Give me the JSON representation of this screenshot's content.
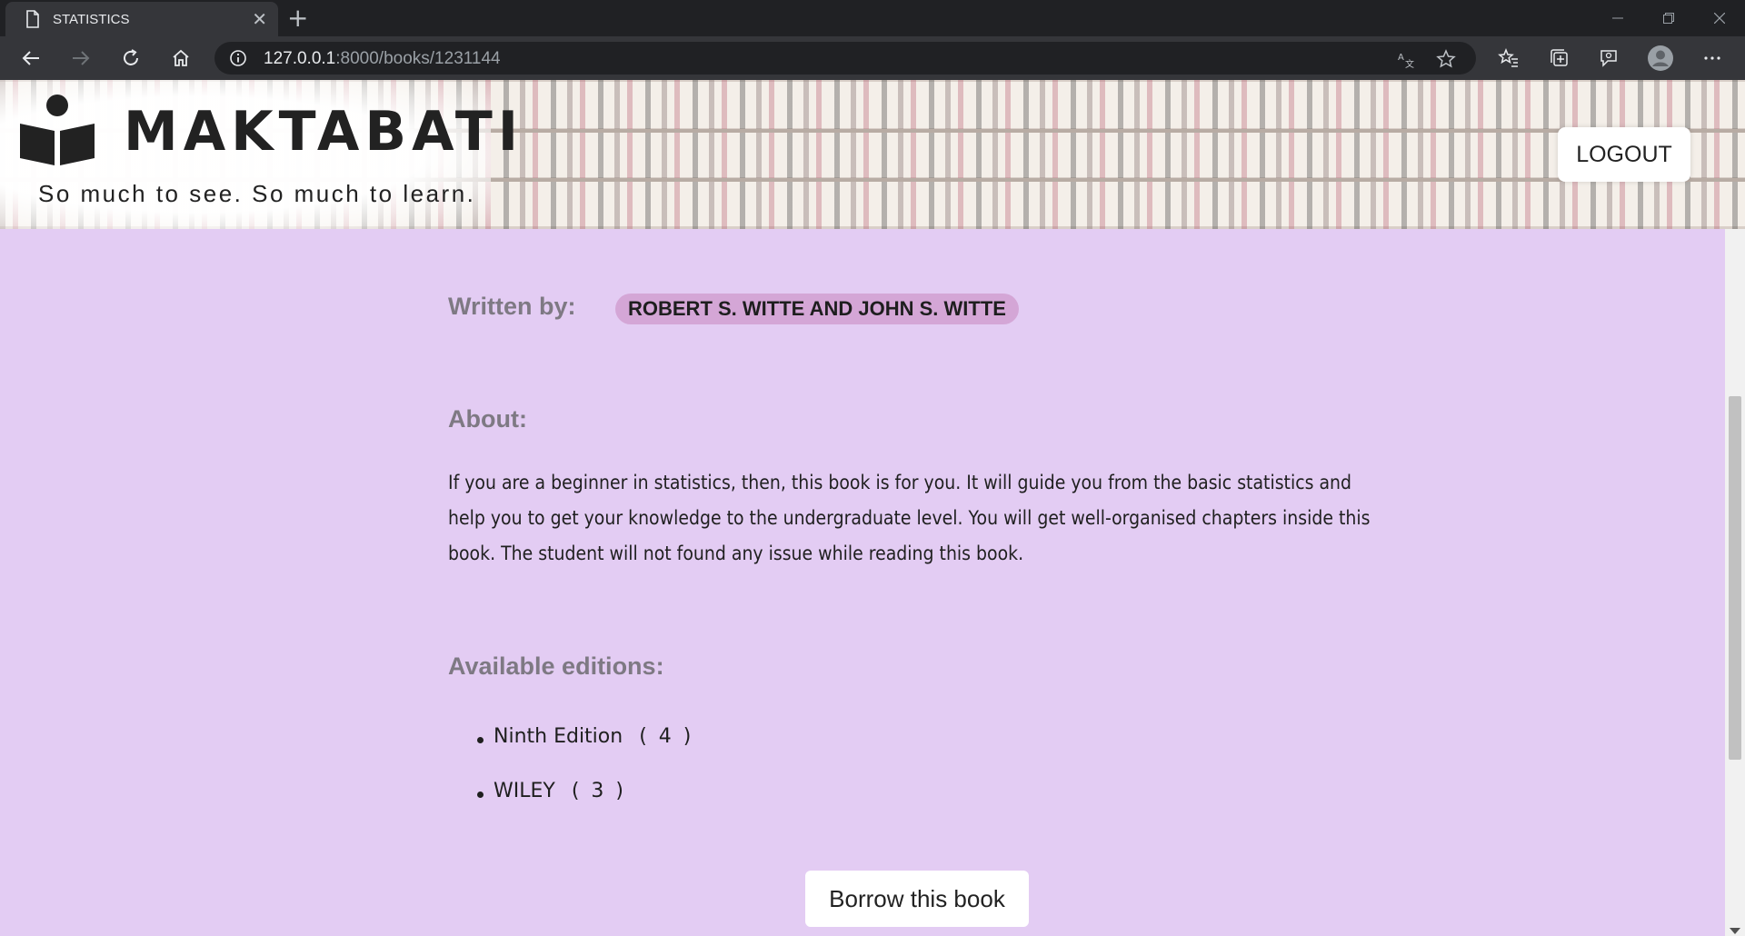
{
  "browser": {
    "tab_title": "STATISTICS",
    "tab_close": "✕",
    "new_tab": "+",
    "url_host": "127.0.0.1",
    "url_rest": ":8000/books/1231144",
    "icons": [
      "back-icon",
      "forward-icon",
      "refresh-icon",
      "home-icon",
      "info-icon",
      "read-aloud-icon",
      "star-icon",
      "favorites-icon",
      "collections-icon",
      "feedback-icon",
      "profile-icon",
      "more-icon"
    ]
  },
  "header": {
    "logo_text": "MAKTABATI",
    "tagline": "So much to see. So much to learn.",
    "logout_label": "LOGOUT"
  },
  "book": {
    "written_by_label": "Written by:",
    "author": "ROBERT S. WITTE AND JOHN S. WITTE",
    "about_label": "About:",
    "about_text": "If you are a beginner in statistics, then, this book is for you. It will guide you from the basic statistics and help you to get your knowledge to the undergraduate level. You will get well-organised chapters inside this book. The student will not found any issue while reading this book.",
    "editions_label": "Available editions:",
    "editions": [
      {
        "name": "Ninth Edition",
        "count": "( 4 )"
      },
      {
        "name": "WILEY",
        "count": "( 3 )"
      }
    ],
    "borrow_label": "Borrow this book"
  },
  "colors": {
    "page_bg": "#e3ccf3",
    "author_pill": "#d4a6d6",
    "label_gray": "#7e7983"
  }
}
